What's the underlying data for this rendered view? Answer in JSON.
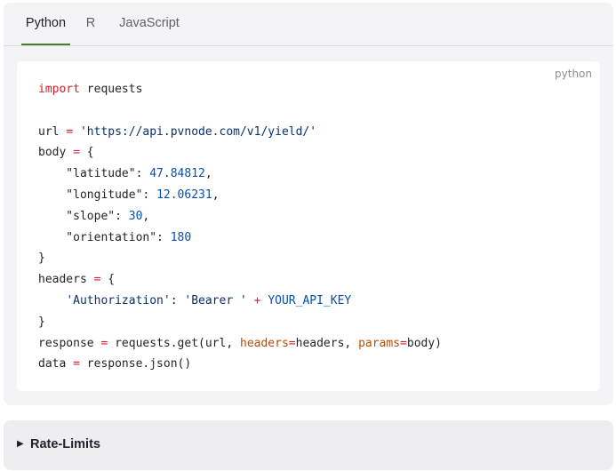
{
  "tabs": [
    {
      "label": "Python",
      "active": true
    },
    {
      "label": "R",
      "active": false
    },
    {
      "label": "JavaScript",
      "active": false
    }
  ],
  "code_block": {
    "language": "python",
    "lines": [
      "import requests",
      "",
      "url = 'https://api.pvnode.com/v1/yield/'",
      "body = {",
      "    \"latitude\": 47.84812,",
      "    \"longitude\": 12.06231,",
      "    \"slope\": 30,",
      "    \"orientation\": 180",
      "}",
      "headers = {",
      "    'Authorization': 'Bearer ' + YOUR_API_KEY",
      "}",
      "response = requests.get(url, headers=headers, params=body)",
      "data = response.json()"
    ]
  },
  "details": {
    "summary": "Rate-Limits",
    "expanded": false
  },
  "colors": {
    "active_tab_underline": "#4a7c2f",
    "keyword": "#cf222e",
    "string": "#0a3069",
    "number": "#0550ae",
    "param": "#bc4c00"
  },
  "icons": {
    "details_toggle": "triangle-right-icon"
  }
}
